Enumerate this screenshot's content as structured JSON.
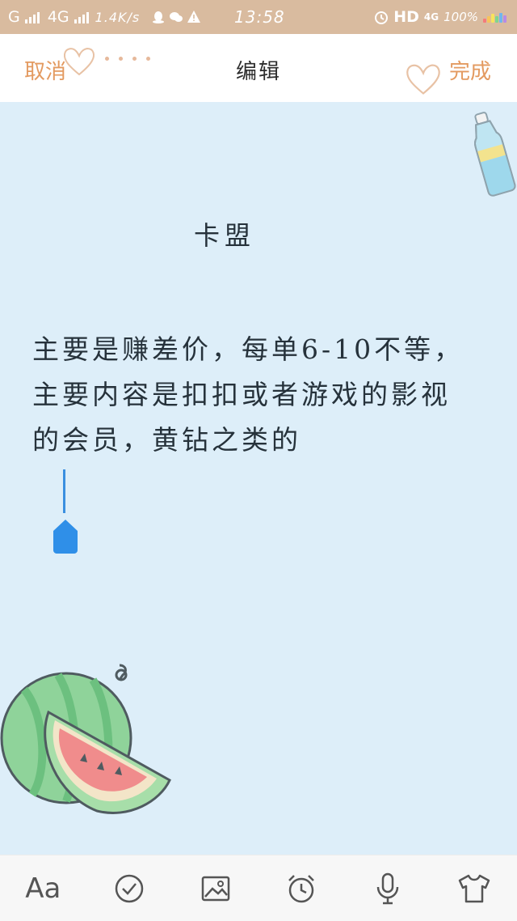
{
  "status_bar": {
    "carrier_left": "G",
    "network_label": "4G",
    "speed": "1.4K/s",
    "time": "13:58",
    "hd_label": "HD",
    "network_right": "4G",
    "battery": "100%"
  },
  "header": {
    "cancel_label": "取消",
    "title": "编辑",
    "done_label": "完成"
  },
  "note": {
    "title": "卡盟",
    "body": "主要是赚差价，每单6-10不等，主要内容是扣扣或者游戏的影视的会员，黄钻之类的"
  },
  "toolbar": {
    "font_label": "Aa",
    "tools": [
      "font-icon",
      "checklist-icon",
      "image-icon",
      "alarm-icon",
      "microphone-icon",
      "theme-shirt-icon"
    ]
  },
  "colors": {
    "status_bar_bg": "#d9bb9f",
    "accent_orange": "#e39a60",
    "paper_bg": "#ddeef9",
    "cursor_blue": "#3a8fe0"
  }
}
